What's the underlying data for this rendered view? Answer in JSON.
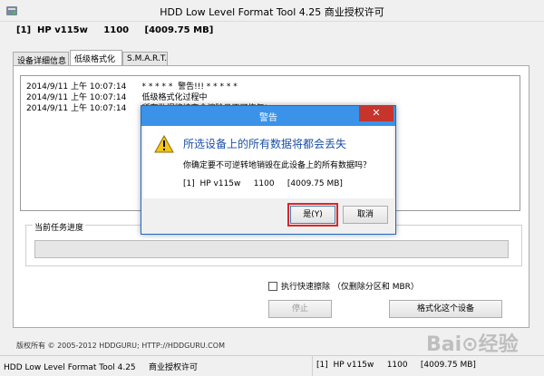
{
  "window": {
    "title": "HDD Low Level Format Tool 4.25     商业授权许可"
  },
  "device_line": "[1]  HP v115w     1100     [4009.75 MB]",
  "tabs": [
    {
      "label": "设备详细信息"
    },
    {
      "label": "低级格式化"
    },
    {
      "label": "S.M.A.R.T."
    }
  ],
  "log": [
    {
      "text": "2014/9/11 上午 10:07:14      * * * * *  警告!!! * * * * *"
    },
    {
      "text": "2014/9/11 上午 10:07:14      低级格式化过程中"
    },
    {
      "text": "2014/9/11 上午 10:07:14      所有数据将被完全擦除且不可恢复!"
    }
  ],
  "progress": {
    "label": "当前任务进度",
    "value": 0
  },
  "quick_erase": {
    "label": "执行快速擦除 （仅删除分区和 MBR）",
    "checked": false
  },
  "buttons": {
    "stop": "停止",
    "format": "格式化这个设备"
  },
  "footer": {
    "copyright": "版权所有 © 2005-2012 HDDGURU;  HTTP://HDDGURU.COM"
  },
  "statusbar": {
    "app": "HDD Low Level Format Tool 4.25     商业授权许可",
    "device": "[1]  HP v115w     1100     [4009.75 MB]"
  },
  "dialog": {
    "title": "警告",
    "main_text": "所选设备上的所有数据将都会丢失",
    "sub_text": "你确定要不可逆转地销毁在此设备上的所有数据吗？",
    "device_text": "[1]  HP v115w     1100     [4009.75 MB]",
    "yes_label": "是(Y)",
    "cancel_label": "取消",
    "close_glyph": "✕",
    "icon": "warning-icon"
  },
  "watermark": "Bai⊙经验",
  "colors": {
    "dialog_title": "#3a93e8",
    "close_button": "#c7342c",
    "main_text": "#1b4fa6",
    "highlight": "#d9262b"
  }
}
